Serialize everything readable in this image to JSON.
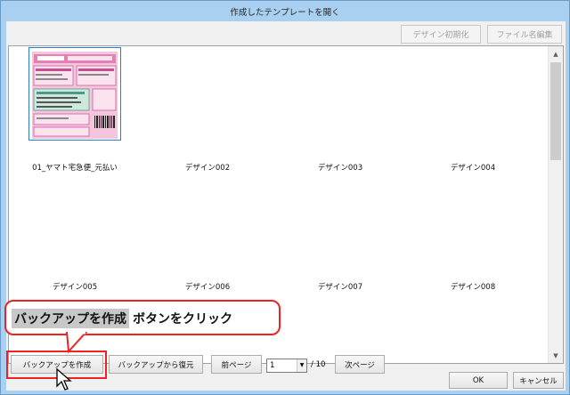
{
  "window": {
    "title": "作成したテンプレートを開く"
  },
  "toolbar": {
    "design_init": "デザイン初期化",
    "file_rename": "ファイル名編集"
  },
  "designs": [
    "01_ヤマト宅急便_元払い",
    "デザイン002",
    "デザイン003",
    "デザイン004",
    "デザイン005",
    "デザイン006",
    "デザイン007",
    "デザイン008"
  ],
  "bottom": {
    "create_backup": "バックアップを作成",
    "restore_backup": "バックアップから復元",
    "prev_page": "前ページ",
    "page_value": "1",
    "page_total": "/ 10",
    "next_page": "次ページ",
    "ok": "OK",
    "cancel": "キャンセル"
  },
  "callout": {
    "highlight": "バックアップを作成",
    "rest": "ボタンをクリック"
  },
  "colors": {
    "accent_red": "#e22222",
    "selection_blue": "#2a7bd8"
  }
}
